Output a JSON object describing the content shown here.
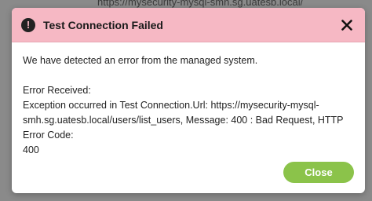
{
  "backdrop": {
    "url_fragment": "https://mysecurity-mysql-smh.sg.uatesb.local/"
  },
  "modal": {
    "title": "Test Connection Failed",
    "alert_icon_glyph": "!",
    "intro": "We have detected an error from the managed system.",
    "error_heading": "Error Received:",
    "error_line_1": "Exception occurred in Test Connection.Url: https://mysecurity-mysql-",
    "error_line_2": "smh.sg.uatesb.local/users/list_users, Message: 400 : Bad Request, HTTP Error Code:",
    "error_line_3": "400",
    "close_label": "Close"
  },
  "colors": {
    "header_bg": "#f6b8c4",
    "button_bg": "#8bc34a"
  },
  "icons": {
    "alert": "alert-circle-icon",
    "close": "close-icon"
  }
}
